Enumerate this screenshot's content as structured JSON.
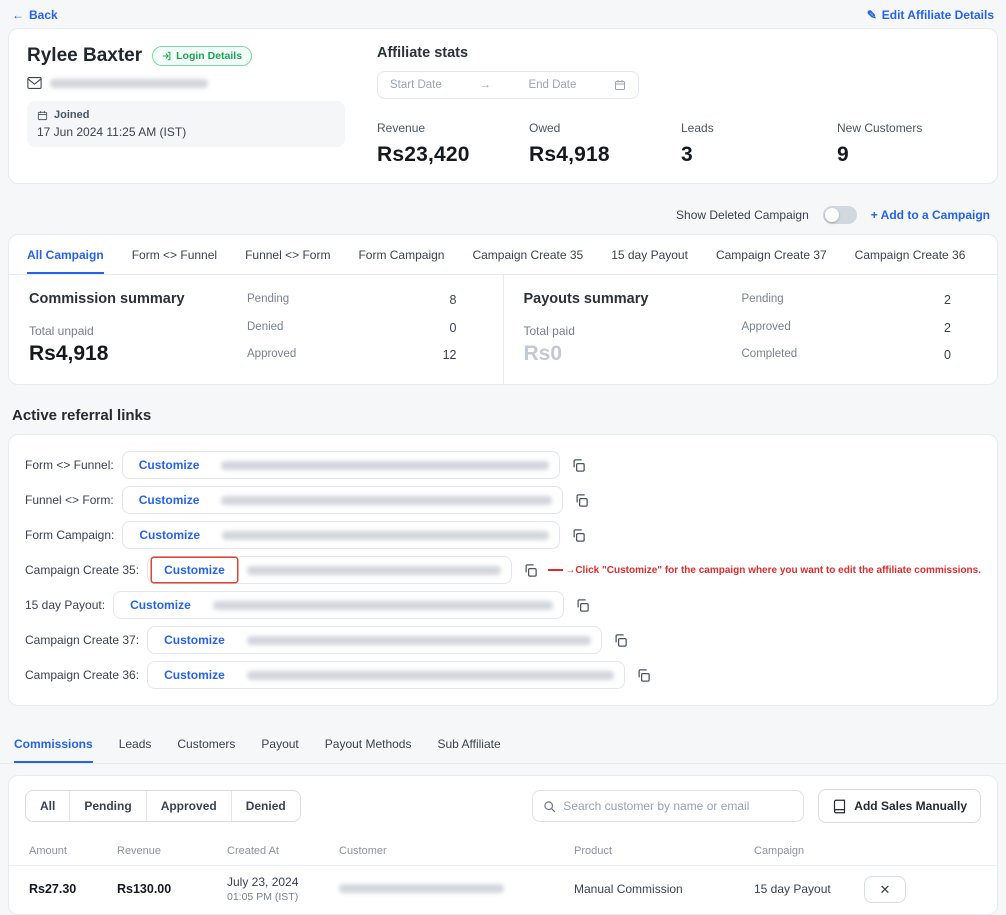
{
  "header": {
    "back_label": "Back",
    "edit_label": "Edit Affiliate Details"
  },
  "profile": {
    "name": "Rylee Baxter",
    "login_details_label": "Login Details",
    "joined_label": "Joined",
    "joined_value": "17 Jun 2024 11:25 AM (IST)"
  },
  "stats": {
    "title": "Affiliate stats",
    "start_date_label": "Start Date",
    "end_date_label": "End Date",
    "items": [
      {
        "label": "Revenue",
        "value": "Rs23,420"
      },
      {
        "label": "Owed",
        "value": "Rs4,918"
      },
      {
        "label": "Leads",
        "value": "3"
      },
      {
        "label": "New Customers",
        "value": "9"
      }
    ]
  },
  "campaign_bar": {
    "toggle_label": "Show Deleted Campaign",
    "add_label": "+ Add to a Campaign"
  },
  "campaign_tabs": [
    "All Campaign",
    "Form <> Funnel",
    "Funnel <> Form",
    "Form Campaign",
    "Campaign Create 35",
    "15 day Payout",
    "Campaign Create 37",
    "Campaign Create 36"
  ],
  "commission_summary": {
    "title": "Commission summary",
    "total_label": "Total unpaid",
    "total_value": "Rs4,918",
    "stats": [
      {
        "label": "Pending",
        "value": "8"
      },
      {
        "label": "Denied",
        "value": "0"
      },
      {
        "label": "Approved",
        "value": "12"
      }
    ]
  },
  "payouts_summary": {
    "title": "Payouts summary",
    "total_label": "Total paid",
    "total_value": "Rs0",
    "stats": [
      {
        "label": "Pending",
        "value": "2"
      },
      {
        "label": "Approved",
        "value": "2"
      },
      {
        "label": "Completed",
        "value": "0"
      }
    ]
  },
  "referral_links": {
    "title": "Active referral links",
    "customize_label": "Customize",
    "rows": [
      {
        "label": "Form <> Funnel:"
      },
      {
        "label": "Funnel <> Form:"
      },
      {
        "label": "Form Campaign:"
      },
      {
        "label": "Campaign Create 35:"
      },
      {
        "label": "15 day Payout:"
      },
      {
        "label": "Campaign Create 37:"
      },
      {
        "label": "Campaign Create 36:"
      }
    ],
    "annotation": "→Click \"Customize\" for the campaign where you want to edit the affiliate commissions."
  },
  "bottom_tabs": [
    "Commissions",
    "Leads",
    "Customers",
    "Payout",
    "Payout Methods",
    "Sub Affiliate"
  ],
  "filters": [
    "All",
    "Pending",
    "Approved",
    "Denied"
  ],
  "search": {
    "placeholder": "Search customer by name or email"
  },
  "add_sales_label": "Add Sales Manually",
  "table": {
    "headers": [
      "Amount",
      "Revenue",
      "Created At",
      "Customer",
      "Product",
      "Campaign"
    ],
    "rows": [
      {
        "amount": "Rs27.30",
        "revenue": "Rs130.00",
        "created_date": "July 23, 2024",
        "created_time": "01:05 PM (IST)",
        "product": "Manual Commission",
        "campaign": "15 day Payout"
      }
    ]
  },
  "colors": {
    "accent_blue": "#2563eb",
    "badge_green": "#1da357",
    "annotation_red": "#e02b2b"
  }
}
